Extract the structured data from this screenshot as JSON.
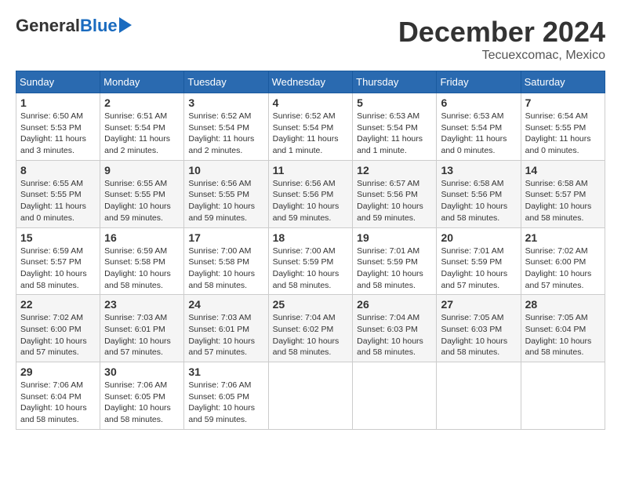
{
  "header": {
    "logo_general": "General",
    "logo_blue": "Blue",
    "month_title": "December 2024",
    "location": "Tecuexcomac, Mexico"
  },
  "calendar": {
    "days_of_week": [
      "Sunday",
      "Monday",
      "Tuesday",
      "Wednesday",
      "Thursday",
      "Friday",
      "Saturday"
    ],
    "weeks": [
      [
        {
          "day": "1",
          "info": "Sunrise: 6:50 AM\nSunset: 5:53 PM\nDaylight: 11 hours\nand 3 minutes."
        },
        {
          "day": "2",
          "info": "Sunrise: 6:51 AM\nSunset: 5:54 PM\nDaylight: 11 hours\nand 2 minutes."
        },
        {
          "day": "3",
          "info": "Sunrise: 6:52 AM\nSunset: 5:54 PM\nDaylight: 11 hours\nand 2 minutes."
        },
        {
          "day": "4",
          "info": "Sunrise: 6:52 AM\nSunset: 5:54 PM\nDaylight: 11 hours\nand 1 minute."
        },
        {
          "day": "5",
          "info": "Sunrise: 6:53 AM\nSunset: 5:54 PM\nDaylight: 11 hours\nand 1 minute."
        },
        {
          "day": "6",
          "info": "Sunrise: 6:53 AM\nSunset: 5:54 PM\nDaylight: 11 hours\nand 0 minutes."
        },
        {
          "day": "7",
          "info": "Sunrise: 6:54 AM\nSunset: 5:55 PM\nDaylight: 11 hours\nand 0 minutes."
        }
      ],
      [
        {
          "day": "8",
          "info": "Sunrise: 6:55 AM\nSunset: 5:55 PM\nDaylight: 11 hours\nand 0 minutes."
        },
        {
          "day": "9",
          "info": "Sunrise: 6:55 AM\nSunset: 5:55 PM\nDaylight: 10 hours\nand 59 minutes."
        },
        {
          "day": "10",
          "info": "Sunrise: 6:56 AM\nSunset: 5:55 PM\nDaylight: 10 hours\nand 59 minutes."
        },
        {
          "day": "11",
          "info": "Sunrise: 6:56 AM\nSunset: 5:56 PM\nDaylight: 10 hours\nand 59 minutes."
        },
        {
          "day": "12",
          "info": "Sunrise: 6:57 AM\nSunset: 5:56 PM\nDaylight: 10 hours\nand 59 minutes."
        },
        {
          "day": "13",
          "info": "Sunrise: 6:58 AM\nSunset: 5:56 PM\nDaylight: 10 hours\nand 58 minutes."
        },
        {
          "day": "14",
          "info": "Sunrise: 6:58 AM\nSunset: 5:57 PM\nDaylight: 10 hours\nand 58 minutes."
        }
      ],
      [
        {
          "day": "15",
          "info": "Sunrise: 6:59 AM\nSunset: 5:57 PM\nDaylight: 10 hours\nand 58 minutes."
        },
        {
          "day": "16",
          "info": "Sunrise: 6:59 AM\nSunset: 5:58 PM\nDaylight: 10 hours\nand 58 minutes."
        },
        {
          "day": "17",
          "info": "Sunrise: 7:00 AM\nSunset: 5:58 PM\nDaylight: 10 hours\nand 58 minutes."
        },
        {
          "day": "18",
          "info": "Sunrise: 7:00 AM\nSunset: 5:59 PM\nDaylight: 10 hours\nand 58 minutes."
        },
        {
          "day": "19",
          "info": "Sunrise: 7:01 AM\nSunset: 5:59 PM\nDaylight: 10 hours\nand 58 minutes."
        },
        {
          "day": "20",
          "info": "Sunrise: 7:01 AM\nSunset: 5:59 PM\nDaylight: 10 hours\nand 57 minutes."
        },
        {
          "day": "21",
          "info": "Sunrise: 7:02 AM\nSunset: 6:00 PM\nDaylight: 10 hours\nand 57 minutes."
        }
      ],
      [
        {
          "day": "22",
          "info": "Sunrise: 7:02 AM\nSunset: 6:00 PM\nDaylight: 10 hours\nand 57 minutes."
        },
        {
          "day": "23",
          "info": "Sunrise: 7:03 AM\nSunset: 6:01 PM\nDaylight: 10 hours\nand 57 minutes."
        },
        {
          "day": "24",
          "info": "Sunrise: 7:03 AM\nSunset: 6:01 PM\nDaylight: 10 hours\nand 57 minutes."
        },
        {
          "day": "25",
          "info": "Sunrise: 7:04 AM\nSunset: 6:02 PM\nDaylight: 10 hours\nand 58 minutes."
        },
        {
          "day": "26",
          "info": "Sunrise: 7:04 AM\nSunset: 6:03 PM\nDaylight: 10 hours\nand 58 minutes."
        },
        {
          "day": "27",
          "info": "Sunrise: 7:05 AM\nSunset: 6:03 PM\nDaylight: 10 hours\nand 58 minutes."
        },
        {
          "day": "28",
          "info": "Sunrise: 7:05 AM\nSunset: 6:04 PM\nDaylight: 10 hours\nand 58 minutes."
        }
      ],
      [
        {
          "day": "29",
          "info": "Sunrise: 7:06 AM\nSunset: 6:04 PM\nDaylight: 10 hours\nand 58 minutes."
        },
        {
          "day": "30",
          "info": "Sunrise: 7:06 AM\nSunset: 6:05 PM\nDaylight: 10 hours\nand 58 minutes."
        },
        {
          "day": "31",
          "info": "Sunrise: 7:06 AM\nSunset: 6:05 PM\nDaylight: 10 hours\nand 59 minutes."
        },
        {
          "day": "",
          "info": ""
        },
        {
          "day": "",
          "info": ""
        },
        {
          "day": "",
          "info": ""
        },
        {
          "day": "",
          "info": ""
        }
      ]
    ]
  }
}
